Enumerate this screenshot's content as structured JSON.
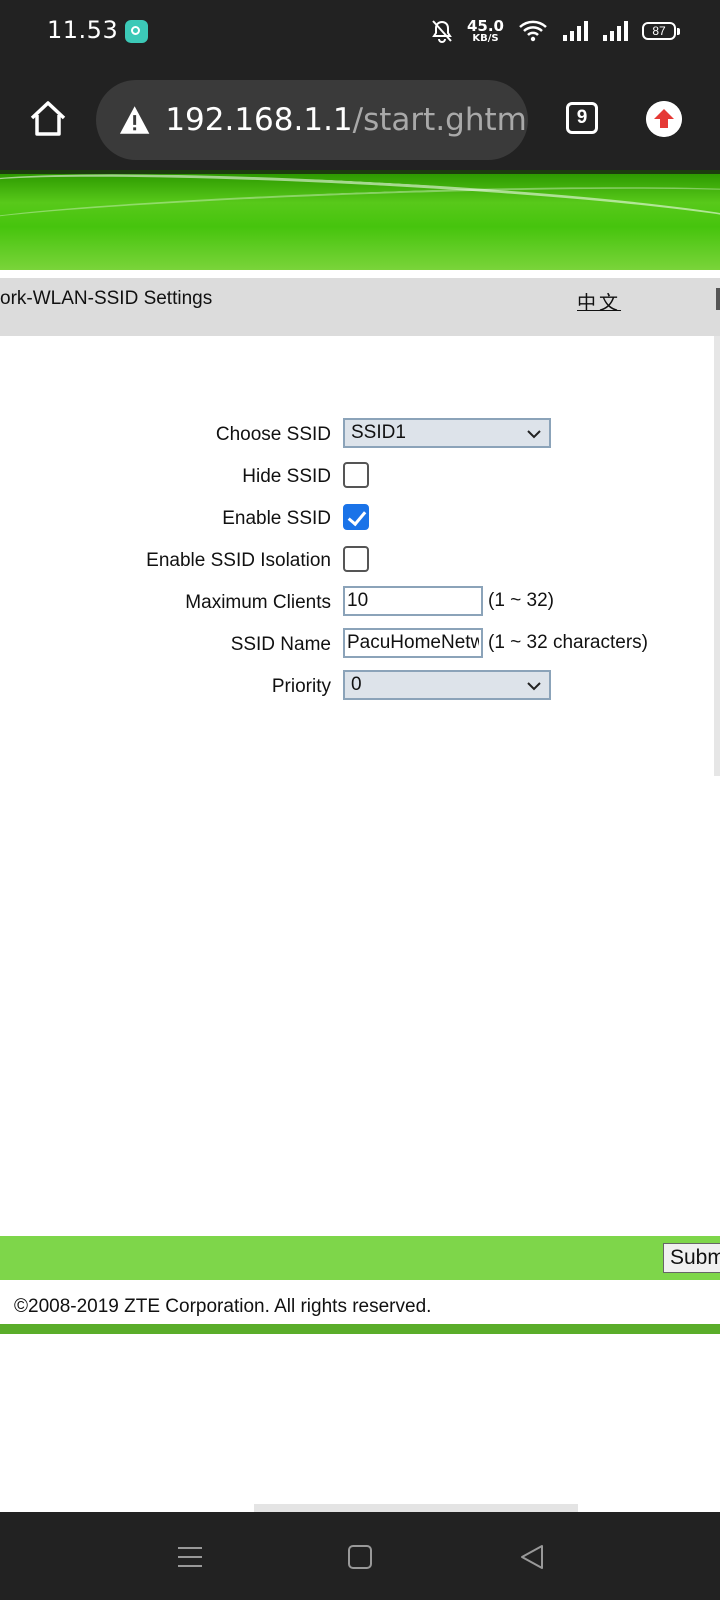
{
  "status_bar": {
    "time": "11.53",
    "net_speed_value": "45.0",
    "net_speed_unit": "KB/S",
    "battery": "87"
  },
  "browser": {
    "url_host": "192.168.1.1",
    "url_path": "/start.ghtml",
    "tab_count": "9"
  },
  "page": {
    "breadcrumb": "ork-WLAN-SSID Settings",
    "language_link": "中文",
    "form": {
      "choose_ssid_label": "Choose SSID",
      "choose_ssid_value": "SSID1",
      "hide_ssid_label": "Hide SSID",
      "hide_ssid_checked": false,
      "enable_ssid_label": "Enable SSID",
      "enable_ssid_checked": true,
      "isolation_label": "Enable SSID Isolation",
      "isolation_checked": false,
      "max_clients_label": "Maximum Clients",
      "max_clients_value": "10",
      "max_clients_hint": "(1 ~ 32)",
      "ssid_name_label": "SSID Name",
      "ssid_name_value": "PacuHomeNetw",
      "ssid_name_hint": "(1 ~ 32 characters)",
      "priority_label": "Priority",
      "priority_value": "0"
    },
    "submit_label": "Subm",
    "copyright": "©2008-2019 ZTE Corporation. All rights reserved."
  },
  "colors": {
    "banner_green": "#46c40d",
    "footer_green": "#7ed64a",
    "checkbox_blue": "#1a73e8",
    "chrome_dark": "#222222"
  }
}
